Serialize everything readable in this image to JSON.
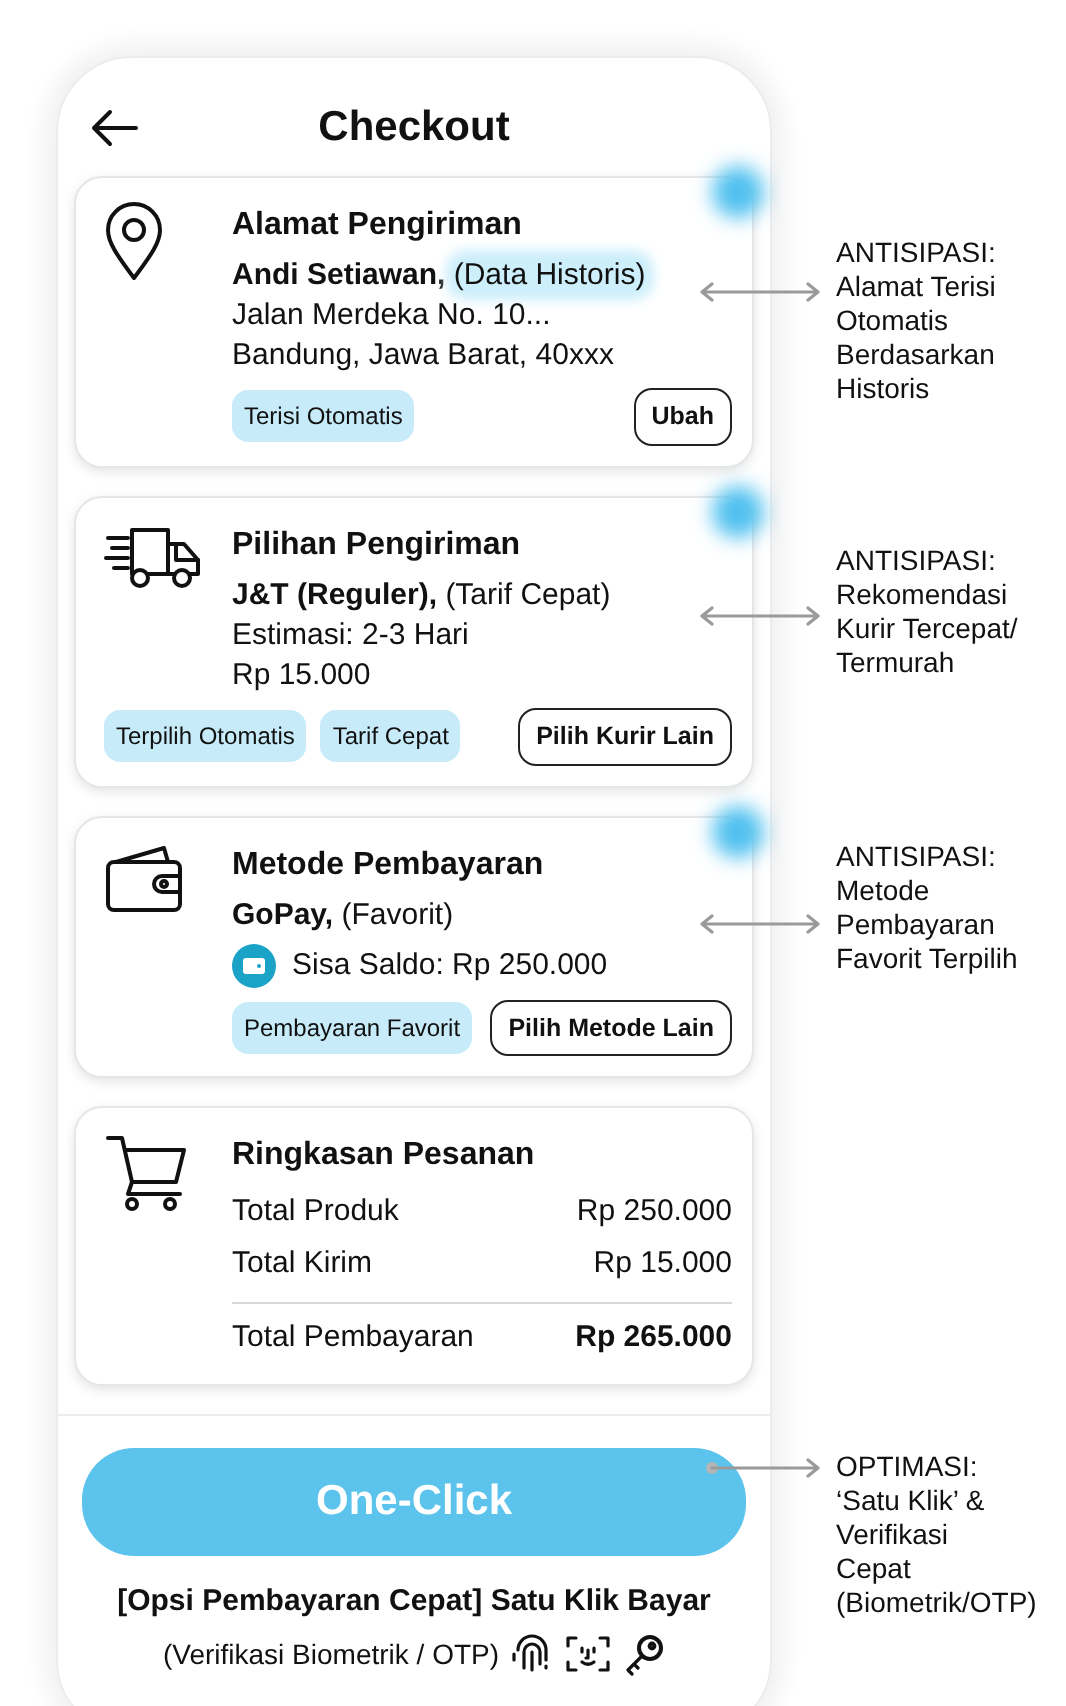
{
  "header": {
    "title": "Checkout"
  },
  "cards": [
    {
      "kind": "address",
      "glow": true,
      "title": "Alamat Pengiriman",
      "lead": {
        "strong": "Andi Setiawan,",
        "note": "(Data Historis)",
        "highlighted": true
      },
      "lines": [
        {
          "kind": "text",
          "text": "Jalan Merdeka No. 10..."
        },
        {
          "kind": "text",
          "text": "Bandung, Jawa Barat, 40xxx"
        }
      ],
      "tags": [
        "Terisi Otomatis"
      ],
      "action": "Ubah",
      "annotation": {
        "kind": "double_arrow",
        "heading": "ANTISIPASI:",
        "lines": [
          "Alamat Terisi",
          "Otomatis",
          "Berdasarkan",
          "Historis"
        ]
      }
    },
    {
      "kind": "shipping",
      "glow": true,
      "title": "Pilihan Pengiriman",
      "lead": {
        "strong": "J&T (Reguler),",
        "note": "(Tarif Cepat)",
        "highlighted": false
      },
      "lines": [
        {
          "kind": "text",
          "text": "Estimasi: 2-3 Hari"
        },
        {
          "kind": "text",
          "text": "Rp 15.000"
        }
      ],
      "tags": [
        "Terpilih Otomatis",
        "Tarif Cepat"
      ],
      "action": "Pilih Kurir Lain",
      "annotation": {
        "kind": "double_arrow",
        "heading": "ANTISIPASI:",
        "lines": [
          "Rekomendasi",
          "Kurir Tercepat/",
          "Termurah"
        ]
      }
    },
    {
      "kind": "payment",
      "glow": true,
      "title": "Metode Pembayaran",
      "lead": {
        "strong": "GoPay,",
        "note": "(Favorit)",
        "highlighted": false
      },
      "lines": [
        {
          "kind": "balance",
          "text": "Sisa Saldo: Rp 250.000"
        }
      ],
      "tags": [
        "Pembayaran Favorit"
      ],
      "action": "Pilih Metode Lain",
      "annotation": {
        "kind": "double_arrow",
        "heading": "ANTISIPASI:",
        "lines": [
          "Metode",
          "Pembayaran",
          "Favorit Terpilih"
        ]
      }
    },
    {
      "kind": "summary",
      "glow": false,
      "title": "Ringkasan Pesanan",
      "rows": [
        {
          "label": "Total Produk",
          "value": "Rp 250.000",
          "total": false
        },
        {
          "label": "Total Kirim",
          "value": "Rp 15.000",
          "total": false
        },
        {
          "label": "Total Pembayaran",
          "value": "Rp 265.000",
          "total": true
        }
      ]
    }
  ],
  "footer": {
    "button": "One-Click",
    "caption": "[Opsi Pembayaran Cepat] Satu Klik Bayar",
    "verification": "(Verifikasi Biometrik / OTP)",
    "annotation": {
      "kind": "arrow",
      "heading": "OPTIMASI:",
      "lines": [
        "‘Satu Klik’ &",
        "Verifikasi",
        "Cepat",
        "(Biometrik/OTP)"
      ]
    }
  }
}
